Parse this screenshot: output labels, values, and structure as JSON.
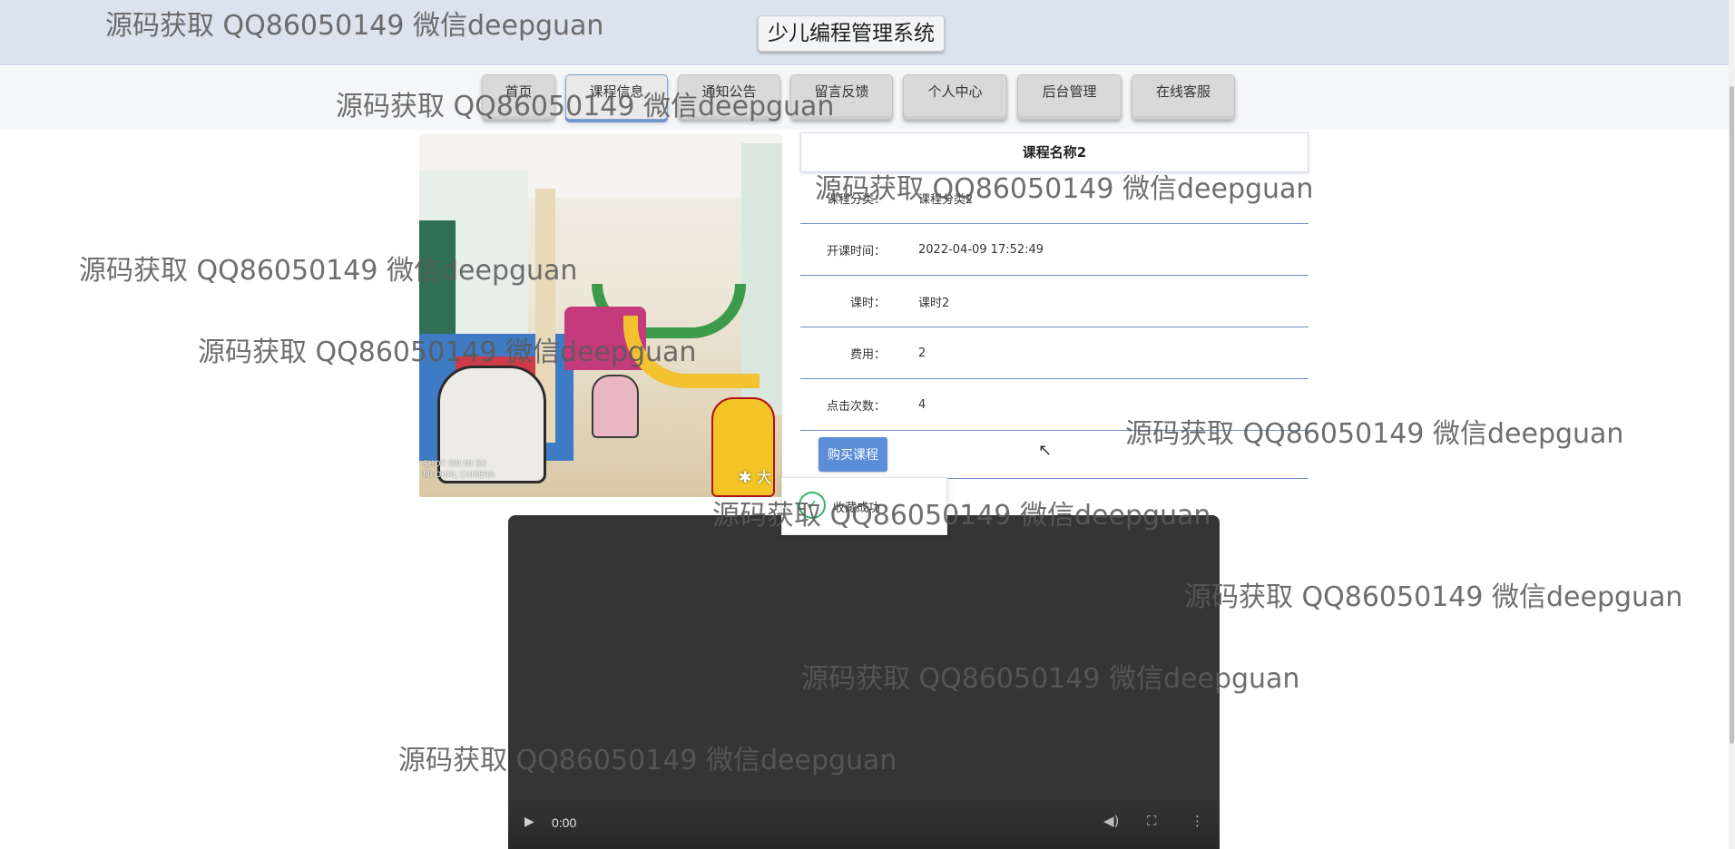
{
  "header": {
    "site_title": "少儿编程管理系统"
  },
  "nav": {
    "items": [
      {
        "label": "首页"
      },
      {
        "label": "课程信息"
      },
      {
        "label": "通知公告"
      },
      {
        "label": "留言反馈"
      },
      {
        "label": "个人中心"
      },
      {
        "label": "后台管理"
      },
      {
        "label": "在线客服"
      }
    ],
    "active_index": 1
  },
  "course_image": {
    "camera_watermark_line1": "SHOT ON MI 5X",
    "camera_watermark_line2": "MI DUAL CAMERA",
    "brand_mark": "大"
  },
  "course": {
    "title": "课程名称2",
    "fields": [
      {
        "label": "课程分类：",
        "value": "课程分类2"
      },
      {
        "label": "开课时间：",
        "value": "2022-04-09 17:52:49"
      },
      {
        "label": "课时：",
        "value": "课时2"
      },
      {
        "label": "费用：",
        "value": "2"
      },
      {
        "label": "点击次数：",
        "value": "4"
      }
    ],
    "buy_label": "购买课程"
  },
  "toast": {
    "text": "收藏成功"
  },
  "video": {
    "time": "0:00"
  },
  "watermark_text": "源码获取 QQ86050149 微信deepguan",
  "colors": {
    "header_bg": "#dbe3ee",
    "accent": "#5b8ed7",
    "row_border": "#6e8fc6",
    "success": "#39b36a",
    "video_bg": "#353535"
  }
}
